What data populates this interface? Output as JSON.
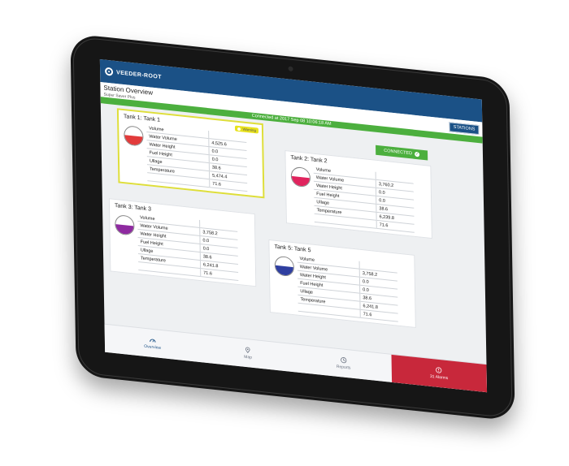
{
  "header": {
    "brand": "VEEDER-ROOT"
  },
  "page": {
    "title": "Station Overview",
    "subtitle": "Super Saver Plus",
    "connection_text": "Connected at 2017 Sep 08 10:06:18 AM",
    "stations_button": "STATIONS",
    "connected_badge": "CONNECTED",
    "warning_badge": "Warning"
  },
  "tanks": [
    {
      "name": "Tank 1: Tank 1",
      "color": "#e23b3b",
      "fill": 0.5,
      "rows": [
        {
          "label": "Volume",
          "value": ""
        },
        {
          "label": "Water Volume",
          "value": "4,525.6"
        },
        {
          "label": "Water Height",
          "value": "0.0"
        },
        {
          "label": "Fuel Height",
          "value": "0.0"
        },
        {
          "label": "Ullage",
          "value": "38.6"
        },
        {
          "label": "Temperature",
          "value": "5,474.4"
        },
        {
          "label": "",
          "value": "71.6"
        }
      ]
    },
    {
      "name": "Tank 2: Tank 2",
      "color": "#e0245e",
      "fill": 0.5,
      "rows": [
        {
          "label": "Volume",
          "value": ""
        },
        {
          "label": "Water Volume",
          "value": "3,760.2"
        },
        {
          "label": "Water Height",
          "value": "0.0"
        },
        {
          "label": "Fuel Height",
          "value": "0.0"
        },
        {
          "label": "Ullage",
          "value": "38.6"
        },
        {
          "label": "Temperature",
          "value": "6,239.8"
        },
        {
          "label": "",
          "value": "71.6"
        }
      ]
    },
    {
      "name": "Tank 3: Tank 3",
      "color": "#8e2aa0",
      "fill": 0.5,
      "rows": [
        {
          "label": "Volume",
          "value": ""
        },
        {
          "label": "Water Volume",
          "value": "3,758.2"
        },
        {
          "label": "Water Height",
          "value": "0.0"
        },
        {
          "label": "Fuel Height",
          "value": "0.0"
        },
        {
          "label": "Ullage",
          "value": "38.6"
        },
        {
          "label": "Temperature",
          "value": "6,241.8"
        },
        {
          "label": "",
          "value": "71.6"
        }
      ]
    },
    {
      "name": "Tank 5: Tank 5",
      "color": "#2f3fa0",
      "fill": 0.5,
      "rows": [
        {
          "label": "Volume",
          "value": ""
        },
        {
          "label": "Water Volume",
          "value": "3,758.2"
        },
        {
          "label": "Water Height",
          "value": "0.0"
        },
        {
          "label": "Fuel Height",
          "value": "0.0"
        },
        {
          "label": "Ullage",
          "value": "38.6"
        },
        {
          "label": "Temperature",
          "value": "6,241.8"
        },
        {
          "label": "",
          "value": "71.6"
        }
      ]
    }
  ],
  "nav": {
    "overview": "Overview",
    "map": "Map",
    "reports": "Reports",
    "alarms": "31 Alarms"
  },
  "colors": {
    "brand": "#1b5186",
    "success": "#4caf3e",
    "alarm": "#c8283b",
    "warning": "#e8e21e"
  }
}
